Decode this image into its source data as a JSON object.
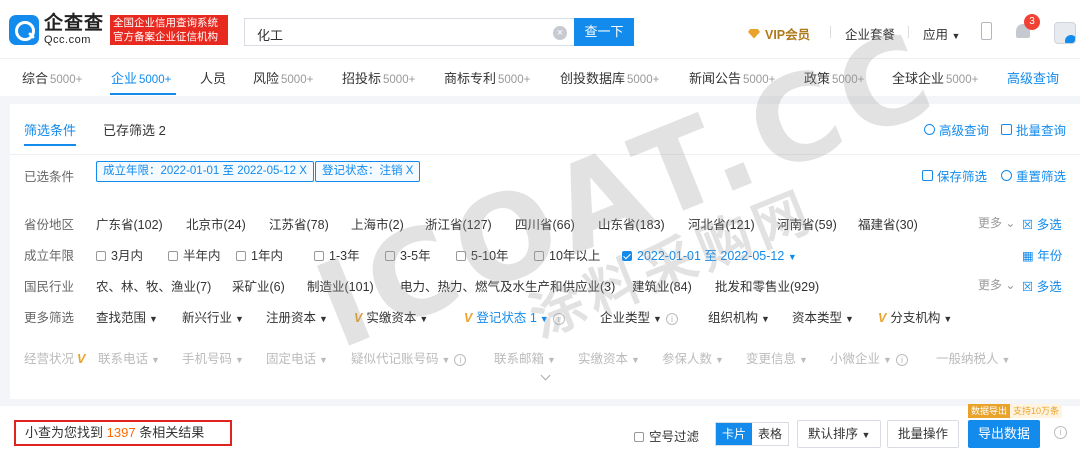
{
  "header": {
    "logo_cn": "企查查",
    "logo_en": "Qcc.com",
    "logo_tag_line1": "全国企业信用查询系统",
    "logo_tag_line2": "官方备案企业征信机构",
    "search_value": "化工",
    "search_button": "查一下",
    "vip": "VIP会员",
    "package": "企业套餐",
    "apps": "应用",
    "notification_count": "3"
  },
  "tabs": [
    {
      "label": "综合",
      "count": "5000+"
    },
    {
      "label": "企业",
      "count": "5000+"
    },
    {
      "label": "人员",
      "count": ""
    },
    {
      "label": "风险",
      "count": "5000+"
    },
    {
      "label": "招投标",
      "count": "5000+"
    },
    {
      "label": "商标专利",
      "count": "5000+"
    },
    {
      "label": "创投数据库",
      "count": "5000+"
    },
    {
      "label": "新闻公告",
      "count": "5000+"
    },
    {
      "label": "政策",
      "count": "5000+"
    },
    {
      "label": "全球企业",
      "count": "5000+"
    },
    {
      "label": "高级查询",
      "count": ""
    }
  ],
  "filter": {
    "tab_active": "筛选条件",
    "tab_saved": "已存筛选 2",
    "advanced": "高级查询",
    "batch": "批量查询",
    "selected_label": "已选条件",
    "chip1": "成立年限：2022-01-01 至 2022-05-12  X",
    "chip2": "登记状态：注销  X",
    "save": "保存筛选",
    "reset": "重置筛选",
    "province_label": "省份地区",
    "provinces": [
      "广东省(102)",
      "北京市(24)",
      "江苏省(78)",
      "上海市(2)",
      "浙江省(127)",
      "四川省(66)",
      "山东省(183)",
      "河北省(121)",
      "河南省(59)",
      "福建省(30)"
    ],
    "more": "更多",
    "multi": "多选",
    "years_label": "成立年限",
    "years": [
      "3月内",
      "半年内",
      "1年内",
      "1-3年",
      "3-5年",
      "5-10年",
      "10年以上",
      "2022-01-01 至 2022-05-12"
    ],
    "years_multi": "年份",
    "industry_label": "国民行业",
    "industries": [
      "农、林、牧、渔业(7)",
      "采矿业(6)",
      "制造业(101)",
      "电力、热力、燃气及水生产和供应业(3)",
      "建筑业(84)",
      "批发和零售业(929)"
    ],
    "more_label": "更多筛选",
    "more_filters": [
      "查找范围",
      "新兴行业",
      "注册资本",
      "实缴资本",
      "登记状态 1",
      "企业类型",
      "组织机构",
      "资本类型",
      "分支机构"
    ],
    "row5": [
      "经营状况",
      "联系电话",
      "手机号码",
      "固定电话",
      "疑似代记账号码",
      "联系邮箱",
      "实缴资本",
      "参保人数",
      "变更信息",
      "小微企业",
      "一般纳税人"
    ]
  },
  "bottom": {
    "result_prefix": "小查为您找到",
    "result_count": "1397",
    "result_suffix": "条相关结果",
    "empty_filter": "空号过滤",
    "view_card": "卡片",
    "view_table": "表格",
    "sort": "默认排序",
    "batch_op": "批量操作",
    "export": "导出数据",
    "export_tag_a": "数据导出",
    "export_tag_b": "支持10万条"
  },
  "watermark": {
    "line1": "ICOAT.CC",
    "line2": "涂料采购网"
  }
}
